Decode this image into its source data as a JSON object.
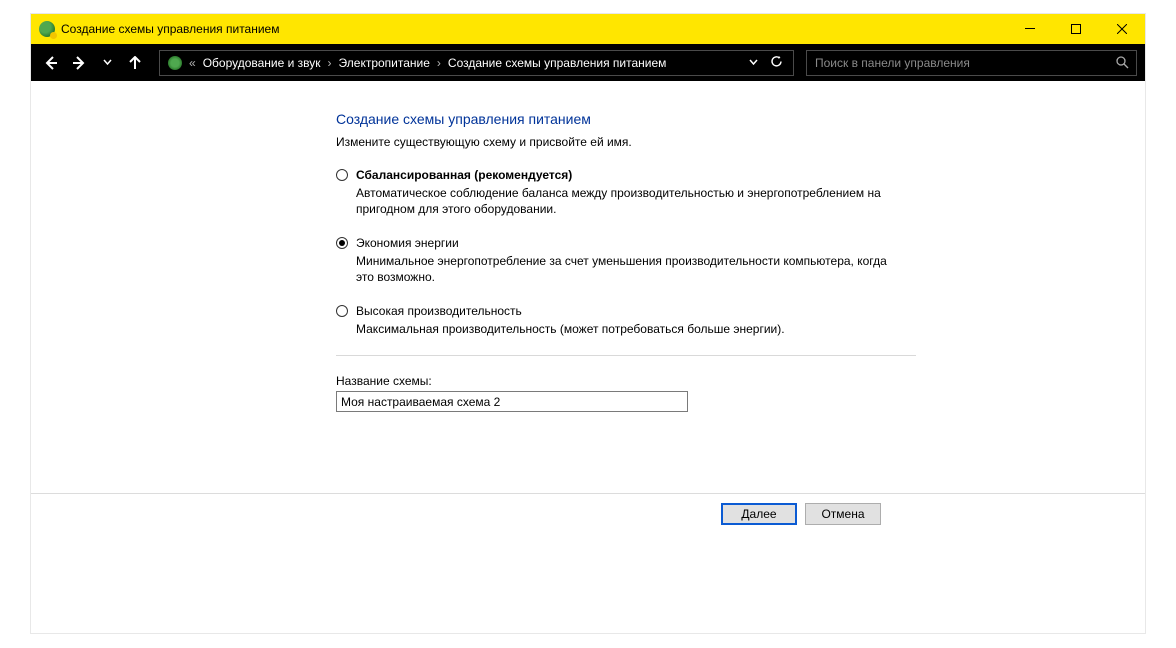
{
  "window": {
    "title": "Создание схемы управления питанием"
  },
  "breadcrumb": {
    "items": [
      "Оборудование и звук",
      "Электропитание",
      "Создание схемы управления питанием"
    ]
  },
  "search": {
    "placeholder": "Поиск в панели управления"
  },
  "page": {
    "title": "Создание схемы управления питанием",
    "subtitle": "Измените существующую схему и присвойте ей имя."
  },
  "options": [
    {
      "label": "Сбалансированная (рекомендуется)",
      "desc": "Автоматическое соблюдение баланса между производительностью и энергопотреблением на пригодном для этого оборудовании.",
      "bold": true,
      "checked": false
    },
    {
      "label": "Экономия энергии",
      "desc": "Минимальное энергопотребление за счет уменьшения производительности компьютера, когда это возможно.",
      "bold": false,
      "checked": true
    },
    {
      "label": "Высокая производительность",
      "desc": "Максимальная производительность (может потребоваться больше энергии).",
      "bold": false,
      "checked": false
    }
  ],
  "plan_name": {
    "label": "Название схемы:",
    "value": "Моя настраиваемая схема 2"
  },
  "buttons": {
    "next": "Далее",
    "cancel": "Отмена"
  }
}
